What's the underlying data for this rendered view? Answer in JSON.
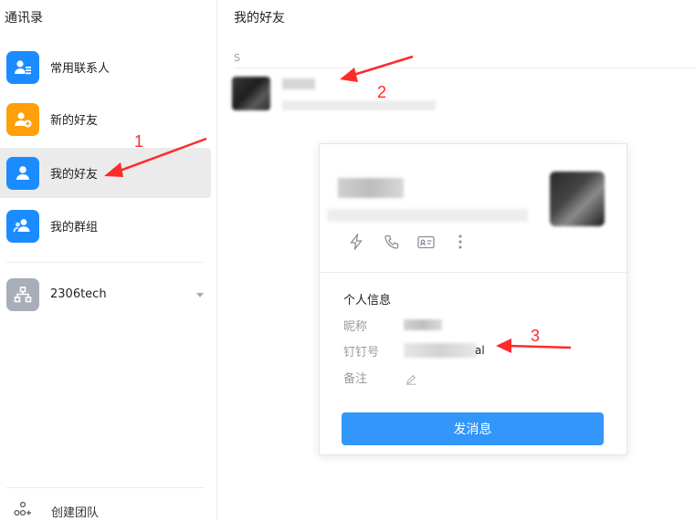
{
  "sidebar": {
    "title": "通讯录",
    "items": [
      {
        "label": "常用联系人",
        "icon": "contact-card-icon",
        "color": "#1a8cff"
      },
      {
        "label": "新的好友",
        "icon": "add-user-icon",
        "color": "#ff9f0a"
      },
      {
        "label": "我的好友",
        "icon": "user-icon",
        "color": "#1a8cff",
        "active": true
      },
      {
        "label": "我的群组",
        "icon": "group-icon",
        "color": "#1a8cff"
      }
    ],
    "org": {
      "label": "2306tech",
      "icon": "org-chart-icon",
      "color": "#a8aeb8"
    },
    "create_team": {
      "label": "创建团队",
      "icon": "team-add-icon"
    }
  },
  "main": {
    "title": "我的好友",
    "section_letter": "S"
  },
  "card": {
    "actions": [
      "lightning-icon",
      "phone-icon",
      "card-icon",
      "more-icon"
    ],
    "info_title": "个人信息",
    "fields": {
      "nickname_label": "昵称",
      "dingtalk_label": "钉钉号",
      "dingtalk_suffix": "al",
      "remark_label": "备注"
    },
    "send_button": "发消息"
  },
  "annotations": {
    "one": "1",
    "two": "2",
    "three": "3",
    "color": "#ff2a2a"
  }
}
